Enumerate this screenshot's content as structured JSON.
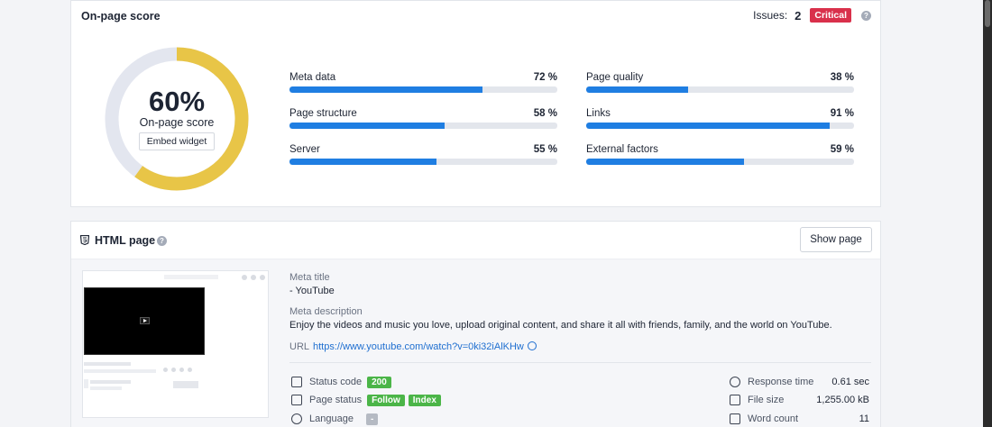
{
  "score_card": {
    "title": "On-page score",
    "issues_label": "Issues:",
    "issues_count": "2",
    "issues_badge": "Critical",
    "score_value": 60,
    "score_text": "60%",
    "score_label": "On-page score",
    "embed_label": "Embed widget",
    "metrics": [
      {
        "label": "Meta data",
        "value_text": "72 %",
        "value": 72
      },
      {
        "label": "Page quality",
        "value_text": "38 %",
        "value": 38
      },
      {
        "label": "Page structure",
        "value_text": "58 %",
        "value": 58
      },
      {
        "label": "Links",
        "value_text": "91 %",
        "value": 91
      },
      {
        "label": "Server",
        "value_text": "55 %",
        "value": 55
      },
      {
        "label": "External factors",
        "value_text": "59 %",
        "value": 59
      }
    ]
  },
  "html_card": {
    "title": "HTML page",
    "show_page_label": "Show page",
    "meta_title_label": "Meta title",
    "meta_title_value": "- YouTube",
    "meta_desc_label": "Meta description",
    "meta_desc_value": "Enjoy the videos and music you love, upload original content, and share it all with friends, family, and the world on YouTube.",
    "url_label": "URL",
    "url_value": "https://www.youtube.com/watch?v=0ki32iAlKHw",
    "left_rows": [
      {
        "label": "Status code",
        "tags": [
          "200"
        ]
      },
      {
        "label": "Page status",
        "tags": [
          "Follow",
          "Index"
        ]
      },
      {
        "label": "Language",
        "tags": [
          "-"
        ]
      }
    ],
    "right_rows": [
      {
        "label": "Response time",
        "value": "0.61 sec"
      },
      {
        "label": "File size",
        "value": "1,255.00 kB"
      },
      {
        "label": "Word count",
        "value": "11"
      }
    ]
  },
  "colors": {
    "accent_blue": "#1f7ee2",
    "gauge_yellow": "#e8c547",
    "gauge_track": "#e3e6ef",
    "critical_red": "#d9304b",
    "tag_green": "#4bb548"
  }
}
